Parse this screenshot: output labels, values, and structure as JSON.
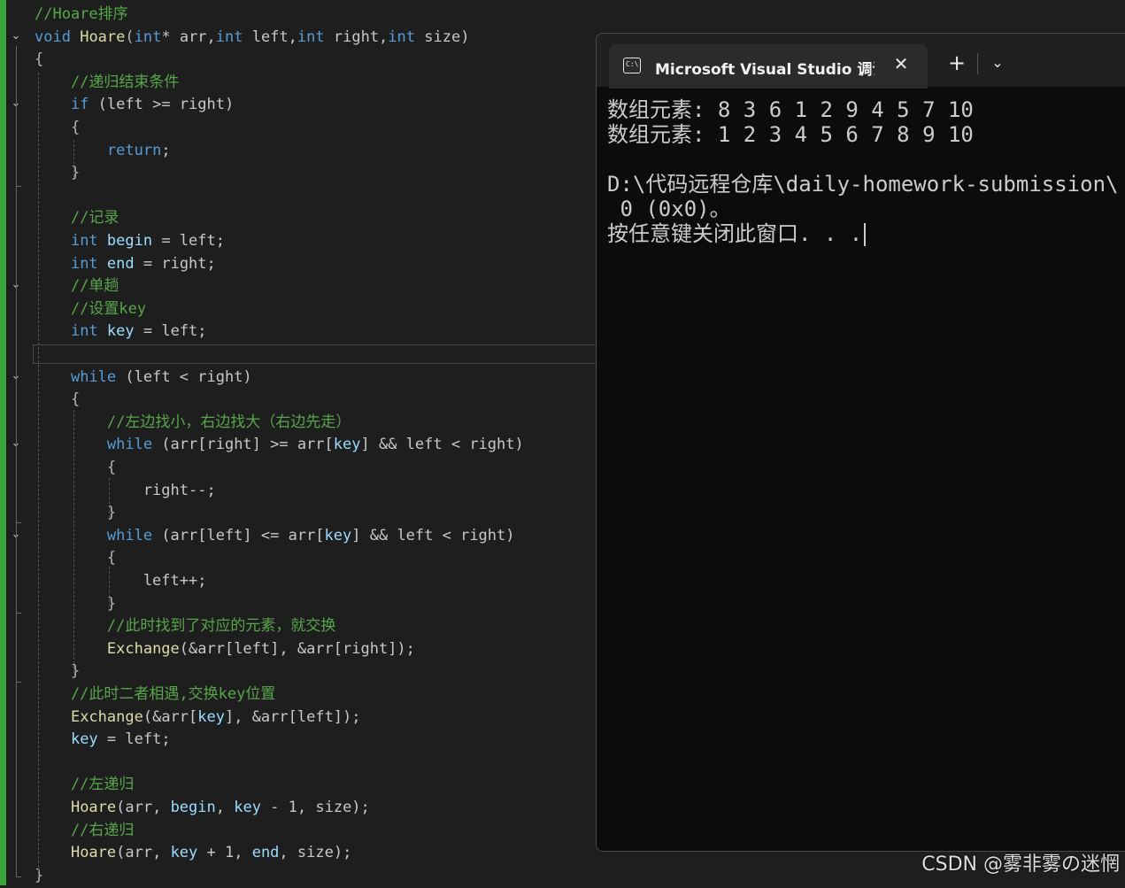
{
  "editor": {
    "lines": [
      {
        "fold": false,
        "tokens": [
          {
            "t": "//Hoare排序",
            "c": "t-comment"
          }
        ]
      },
      {
        "fold": true,
        "tokens": [
          {
            "t": "void",
            "c": "t-kw"
          },
          {
            "t": " ",
            "c": "t-plain"
          },
          {
            "t": "Hoare",
            "c": "t-fn"
          },
          {
            "t": "(",
            "c": "t-punct"
          },
          {
            "t": "int",
            "c": "t-kw"
          },
          {
            "t": "* arr,",
            "c": "t-plain"
          },
          {
            "t": "int",
            "c": "t-kw"
          },
          {
            "t": " left,",
            "c": "t-plain"
          },
          {
            "t": "int",
            "c": "t-kw"
          },
          {
            "t": " right,",
            "c": "t-plain"
          },
          {
            "t": "int",
            "c": "t-kw"
          },
          {
            "t": " size)",
            "c": "t-plain"
          }
        ]
      },
      {
        "fold": false,
        "tokens": [
          {
            "t": "{",
            "c": "t-punct"
          }
        ]
      },
      {
        "fold": false,
        "tokens": [
          {
            "t": "    //递归结束条件",
            "c": "t-comment"
          }
        ]
      },
      {
        "fold": true,
        "tokens": [
          {
            "t": "    ",
            "c": "t-plain"
          },
          {
            "t": "if",
            "c": "t-kw"
          },
          {
            "t": " (left >= right)",
            "c": "t-plain"
          }
        ]
      },
      {
        "fold": false,
        "tokens": [
          {
            "t": "    {",
            "c": "t-punct"
          }
        ]
      },
      {
        "fold": false,
        "tokens": [
          {
            "t": "        ",
            "c": "t-plain"
          },
          {
            "t": "return",
            "c": "t-kw"
          },
          {
            "t": ";",
            "c": "t-plain"
          }
        ]
      },
      {
        "fold": false,
        "tokens": [
          {
            "t": "    }",
            "c": "t-punct"
          }
        ]
      },
      {
        "fold": false,
        "tokens": [
          {
            "t": "",
            "c": "t-plain"
          }
        ]
      },
      {
        "fold": false,
        "tokens": [
          {
            "t": "    //记录",
            "c": "t-comment"
          }
        ]
      },
      {
        "fold": false,
        "tokens": [
          {
            "t": "    ",
            "c": "t-plain"
          },
          {
            "t": "int",
            "c": "t-kw"
          },
          {
            "t": " ",
            "c": "t-plain"
          },
          {
            "t": "begin",
            "c": "t-var"
          },
          {
            "t": " = left;",
            "c": "t-plain"
          }
        ]
      },
      {
        "fold": false,
        "tokens": [
          {
            "t": "    ",
            "c": "t-plain"
          },
          {
            "t": "int",
            "c": "t-kw"
          },
          {
            "t": " ",
            "c": "t-plain"
          },
          {
            "t": "end",
            "c": "t-var"
          },
          {
            "t": " = right;",
            "c": "t-plain"
          }
        ]
      },
      {
        "fold": true,
        "tokens": [
          {
            "t": "    //单趟",
            "c": "t-comment"
          }
        ]
      },
      {
        "fold": false,
        "tokens": [
          {
            "t": "    //设置key",
            "c": "t-comment"
          }
        ]
      },
      {
        "fold": false,
        "tokens": [
          {
            "t": "    ",
            "c": "t-plain"
          },
          {
            "t": "int",
            "c": "t-kw"
          },
          {
            "t": " ",
            "c": "t-plain"
          },
          {
            "t": "key",
            "c": "t-var"
          },
          {
            "t": " = left;",
            "c": "t-plain"
          }
        ]
      },
      {
        "fold": false,
        "tokens": [
          {
            "t": "",
            "c": "t-plain"
          }
        ]
      },
      {
        "fold": true,
        "tokens": [
          {
            "t": "    ",
            "c": "t-plain"
          },
          {
            "t": "while",
            "c": "t-kw"
          },
          {
            "t": " (left < right)",
            "c": "t-plain"
          }
        ]
      },
      {
        "fold": false,
        "tokens": [
          {
            "t": "    {",
            "c": "t-punct"
          }
        ]
      },
      {
        "fold": false,
        "tokens": [
          {
            "t": "        //左边找小，右边找大（右边先走）",
            "c": "t-comment"
          }
        ]
      },
      {
        "fold": true,
        "tokens": [
          {
            "t": "        ",
            "c": "t-plain"
          },
          {
            "t": "while",
            "c": "t-kw"
          },
          {
            "t": " (arr[right] >= arr[",
            "c": "t-plain"
          },
          {
            "t": "key",
            "c": "t-var"
          },
          {
            "t": "] && left < right)",
            "c": "t-plain"
          }
        ]
      },
      {
        "fold": false,
        "tokens": [
          {
            "t": "        {",
            "c": "t-punct"
          }
        ]
      },
      {
        "fold": false,
        "tokens": [
          {
            "t": "            right--;",
            "c": "t-plain"
          }
        ]
      },
      {
        "fold": false,
        "tokens": [
          {
            "t": "        }",
            "c": "t-punct"
          }
        ]
      },
      {
        "fold": true,
        "tokens": [
          {
            "t": "        ",
            "c": "t-plain"
          },
          {
            "t": "while",
            "c": "t-kw"
          },
          {
            "t": " (arr[left] <= arr[",
            "c": "t-plain"
          },
          {
            "t": "key",
            "c": "t-var"
          },
          {
            "t": "] && left < right)",
            "c": "t-plain"
          }
        ]
      },
      {
        "fold": false,
        "tokens": [
          {
            "t": "        {",
            "c": "t-punct"
          }
        ]
      },
      {
        "fold": false,
        "tokens": [
          {
            "t": "            left++;",
            "c": "t-plain"
          }
        ]
      },
      {
        "fold": false,
        "tokens": [
          {
            "t": "        }",
            "c": "t-punct"
          }
        ]
      },
      {
        "fold": false,
        "tokens": [
          {
            "t": "        //此时找到了对应的元素，就交换",
            "c": "t-comment"
          }
        ]
      },
      {
        "fold": false,
        "tokens": [
          {
            "t": "        ",
            "c": "t-plain"
          },
          {
            "t": "Exchange",
            "c": "t-fn"
          },
          {
            "t": "(&arr[left], &arr[right]);",
            "c": "t-plain"
          }
        ]
      },
      {
        "fold": false,
        "tokens": [
          {
            "t": "    }",
            "c": "t-punct"
          }
        ]
      },
      {
        "fold": false,
        "tokens": [
          {
            "t": "    //此时二者相遇,交换key位置",
            "c": "t-comment"
          }
        ]
      },
      {
        "fold": false,
        "tokens": [
          {
            "t": "    ",
            "c": "t-plain"
          },
          {
            "t": "Exchange",
            "c": "t-fn"
          },
          {
            "t": "(&arr[",
            "c": "t-plain"
          },
          {
            "t": "key",
            "c": "t-var"
          },
          {
            "t": "], &arr[left]);",
            "c": "t-plain"
          }
        ]
      },
      {
        "fold": false,
        "tokens": [
          {
            "t": "    ",
            "c": "t-plain"
          },
          {
            "t": "key",
            "c": "t-var"
          },
          {
            "t": " = left;",
            "c": "t-plain"
          }
        ]
      },
      {
        "fold": false,
        "tokens": [
          {
            "t": "",
            "c": "t-plain"
          }
        ]
      },
      {
        "fold": false,
        "tokens": [
          {
            "t": "    //左递归",
            "c": "t-comment"
          }
        ]
      },
      {
        "fold": false,
        "tokens": [
          {
            "t": "    ",
            "c": "t-plain"
          },
          {
            "t": "Hoare",
            "c": "t-fn"
          },
          {
            "t": "(arr, ",
            "c": "t-plain"
          },
          {
            "t": "begin",
            "c": "t-var"
          },
          {
            "t": ", ",
            "c": "t-plain"
          },
          {
            "t": "key",
            "c": "t-var"
          },
          {
            "t": " - 1, size);",
            "c": "t-plain"
          }
        ]
      },
      {
        "fold": false,
        "tokens": [
          {
            "t": "    //右递归",
            "c": "t-comment"
          }
        ]
      },
      {
        "fold": false,
        "tokens": [
          {
            "t": "    ",
            "c": "t-plain"
          },
          {
            "t": "Hoare",
            "c": "t-fn"
          },
          {
            "t": "(arr, ",
            "c": "t-plain"
          },
          {
            "t": "key",
            "c": "t-var"
          },
          {
            "t": " + 1, ",
            "c": "t-plain"
          },
          {
            "t": "end",
            "c": "t-var"
          },
          {
            "t": ", size);",
            "c": "t-plain"
          }
        ]
      },
      {
        "fold": false,
        "tokens": [
          {
            "t": "}",
            "c": "t-punct"
          }
        ]
      }
    ]
  },
  "console": {
    "tab_title": "Microsoft Visual Studio 调试控制台",
    "icon_glyph": "C:\\",
    "close_glyph": "✕",
    "new_tab_glyph": "+",
    "dropdown_glyph": "⌄",
    "output": [
      "数组元素: 8 3 6 1 2 9 4 5 7 10",
      "数组元素: 1 2 3 4 5 6 7 8 9 10",
      "",
      "D:\\代码远程仓库\\daily-homework-submission\\",
      " 0 (0x0)。",
      "按任意键关闭此窗口. . ."
    ]
  },
  "watermark": "CSDN @雾非雾の迷惘",
  "colors": {
    "comment": "#57a64a",
    "keyword": "#569cd6",
    "function": "#dcdcaa",
    "variable": "#9cdcfe",
    "git_bar": "#3aa53a"
  }
}
